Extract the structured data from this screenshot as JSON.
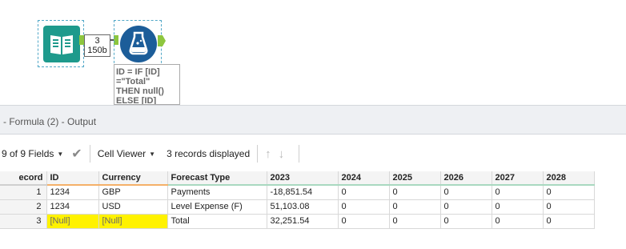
{
  "canvas": {
    "connection": {
      "records": "3",
      "size": "150b"
    },
    "annotation_lines": [
      "ID = IF [ID]",
      "=\"Total\"",
      "THEN null()",
      "ELSE [ID]"
    ]
  },
  "panel": {
    "title": "- Formula (2) - Output",
    "toolbar": {
      "fields": "9 of 9 Fields",
      "viewer": "Cell Viewer",
      "status": "3 records displayed"
    }
  },
  "grid": {
    "headers": [
      "ecord",
      "ID",
      "Currency",
      "Forecast Type",
      "2023",
      "2024",
      "2025",
      "2026",
      "2027",
      "2028"
    ],
    "rows": [
      [
        "1",
        "1234",
        "GBP",
        "Payments",
        "-18,851.54",
        "0",
        "0",
        "0",
        "0",
        "0"
      ],
      [
        "2",
        "1234",
        "USD",
        "Level Expense (F)",
        "51,103.08",
        "0",
        "0",
        "0",
        "0",
        "0"
      ],
      [
        "3",
        "[Null]",
        "[Null]",
        "Total",
        "32,251.54",
        "0",
        "0",
        "0",
        "0",
        "0"
      ]
    ]
  },
  "colors": {
    "input_tool": "#1e9a8c",
    "formula_tool": "#1c5d99",
    "anchor": "#8dc63f",
    "null_highlight": "#fff200"
  }
}
